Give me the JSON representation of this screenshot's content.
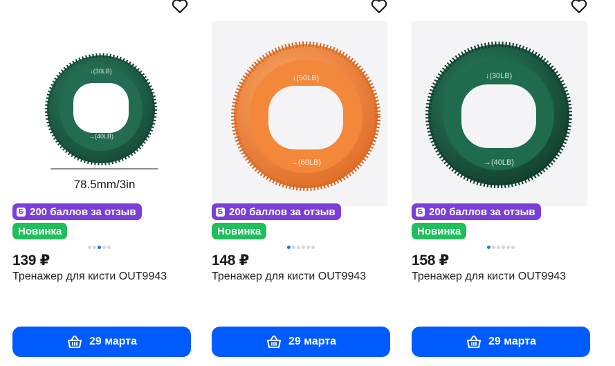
{
  "products": [
    {
      "points_badge": "200 баллов за отзыв",
      "points_icon_letter": "Б",
      "new_badge": "Новинка",
      "price": "139 ₽",
      "title": "Тренажер для кисти OUT9943",
      "delivery_label": "29 марта",
      "image": {
        "ring_color": "#1f6b4e",
        "label_top": "↓(30LB)",
        "label_bottom": "→(40LB)",
        "size_caption": "78.5mm/3in"
      },
      "carousel": {
        "count": 5,
        "active": 3
      }
    },
    {
      "points_badge": "200 баллов за отзыв",
      "points_icon_letter": "Б",
      "new_badge": "Новинка",
      "price": "148 ₽",
      "title": "Тренажер для кисти OUT9943",
      "delivery_label": "29 марта",
      "image": {
        "ring_color": "#f08a3c",
        "label_top": "↓(50LB)",
        "label_bottom": "→(60LB)"
      },
      "carousel": {
        "count": 6,
        "active": 1
      }
    },
    {
      "points_badge": "200 баллов за отзыв",
      "points_icon_letter": "Б",
      "new_badge": "Новинка",
      "price": "158 ₽",
      "title": "Тренажер для кисти OUT9943",
      "delivery_label": "29 марта",
      "image": {
        "ring_color": "#1f6b4e",
        "label_top": "↓(30LB)",
        "label_bottom": "→(40LB)"
      },
      "carousel": {
        "count": 6,
        "active": 1
      }
    }
  ],
  "colors": {
    "accent_blue": "#005bff",
    "points_purple": "#7b3fd8",
    "new_green": "#1fbf5c",
    "dot_active": "#1d6ff2",
    "dot_inactive": "#d3d6dd"
  },
  "icons": {
    "favorite": "heart-outline-icon",
    "cart": "basket-icon"
  }
}
